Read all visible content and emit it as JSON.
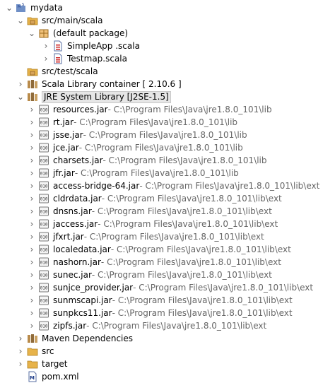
{
  "tree": {
    "project": {
      "name": "mydata",
      "badge": "M S"
    },
    "src_main": "src/main/scala",
    "default_package": "(default package)",
    "files": [
      "SimpleApp .scala",
      "Testmap.scala"
    ],
    "src_test": "src/test/scala",
    "scala_library": "Scala Library container [ 2.10.6 ]",
    "jre_library": "JRE System Library [J2SE-1.5]",
    "jars": [
      {
        "name": "resources.jar",
        "path": " - C:\\Program Files\\Java\\jre1.8.0_101\\lib"
      },
      {
        "name": "rt.jar",
        "path": " - C:\\Program Files\\Java\\jre1.8.0_101\\lib"
      },
      {
        "name": "jsse.jar",
        "path": " - C:\\Program Files\\Java\\jre1.8.0_101\\lib"
      },
      {
        "name": "jce.jar",
        "path": " - C:\\Program Files\\Java\\jre1.8.0_101\\lib"
      },
      {
        "name": "charsets.jar",
        "path": " - C:\\Program Files\\Java\\jre1.8.0_101\\lib"
      },
      {
        "name": "jfr.jar",
        "path": " - C:\\Program Files\\Java\\jre1.8.0_101\\lib"
      },
      {
        "name": "access-bridge-64.jar",
        "path": " - C:\\Program Files\\Java\\jre1.8.0_101\\lib\\ext"
      },
      {
        "name": "cldrdata.jar",
        "path": " - C:\\Program Files\\Java\\jre1.8.0_101\\lib\\ext"
      },
      {
        "name": "dnsns.jar",
        "path": " - C:\\Program Files\\Java\\jre1.8.0_101\\lib\\ext"
      },
      {
        "name": "jaccess.jar",
        "path": " - C:\\Program Files\\Java\\jre1.8.0_101\\lib\\ext"
      },
      {
        "name": "jfxrt.jar",
        "path": " - C:\\Program Files\\Java\\jre1.8.0_101\\lib\\ext"
      },
      {
        "name": "localedata.jar",
        "path": " - C:\\Program Files\\Java\\jre1.8.0_101\\lib\\ext"
      },
      {
        "name": "nashorn.jar",
        "path": " - C:\\Program Files\\Java\\jre1.8.0_101\\lib\\ext"
      },
      {
        "name": "sunec.jar",
        "path": " - C:\\Program Files\\Java\\jre1.8.0_101\\lib\\ext"
      },
      {
        "name": "sunjce_provider.jar",
        "path": " - C:\\Program Files\\Java\\jre1.8.0_101\\lib\\ext"
      },
      {
        "name": "sunmscapi.jar",
        "path": " - C:\\Program Files\\Java\\jre1.8.0_101\\lib\\ext"
      },
      {
        "name": "sunpkcs11.jar",
        "path": " - C:\\Program Files\\Java\\jre1.8.0_101\\lib\\ext"
      },
      {
        "name": "zipfs.jar",
        "path": " - C:\\Program Files\\Java\\jre1.8.0_101\\lib\\ext"
      }
    ],
    "maven_dependencies": "Maven Dependencies",
    "src": "src",
    "target": "target",
    "pom": "pom.xml"
  },
  "icons": {
    "project": "eclipse-project-icon",
    "source_folder": "package-folder-icon",
    "package": "package-icon",
    "scala_file": "scala-file-icon",
    "library": "library-icon",
    "jar": "jar-icon",
    "folder": "folder-icon",
    "pom": "pom-file-icon"
  },
  "colors": {
    "text": "#000000",
    "path": "#666666",
    "selection": "#e6e6e6",
    "folder": "#e7b34a"
  }
}
